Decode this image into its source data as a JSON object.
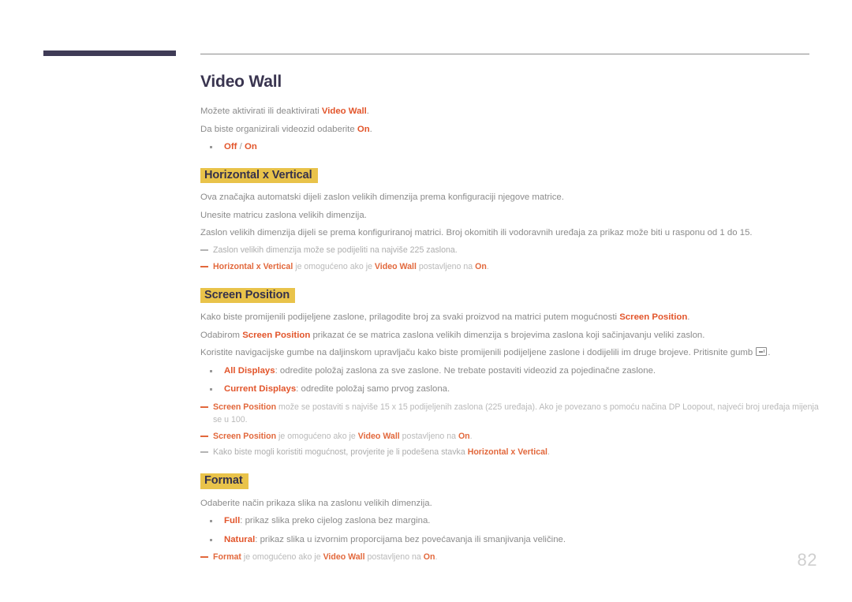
{
  "document": {
    "title": "Video Wall",
    "page_number": "82"
  },
  "colors": {
    "accent_orange": "#e2552b",
    "note_orange": "#e2683c",
    "highlight_gold": "#e9c34a",
    "title_navy": "#3a3550",
    "header_bar_navy": "#3f3b56",
    "body_gray": "#8b8b8b",
    "note_gray": "#adadad",
    "page_number_gray": "#cfcfcf"
  },
  "intro": {
    "line1_pre": "Možete aktivirati ili deaktivirati ",
    "line1_em": "Video Wall",
    "line1_post": ".",
    "line2_pre": "Da biste organizirali videozid odaberite ",
    "line2_em": "On",
    "line2_post": ".",
    "option_off": "Off",
    "option_slash": " / ",
    "option_on": "On"
  },
  "sections": [
    {
      "heading": "Horizontal x Vertical",
      "paragraphs": [
        "Ova značajka automatski dijeli zaslon velikih dimenzija prema konfiguraciji njegove matrice.",
        "Unesite matricu zaslona velikih dimenzija.",
        "Zaslon velikih dimenzija dijeli se prema konfiguriranoj matrici. Broj okomitih ili vodoravnih uređaja za prikaz može biti u rasponu od 1 do 15."
      ],
      "notes": [
        {
          "style": "gray",
          "parts": [
            {
              "text": "Zaslon velikih dimenzija može se podijeliti na najviše 225 zaslona.",
              "emphasis": false
            }
          ]
        },
        {
          "style": "accent",
          "parts": [
            {
              "text": "Horizontal x Vertical",
              "emphasis": true
            },
            {
              "text": " je omogućeno ako je ",
              "emphasis": false
            },
            {
              "text": "Video Wall",
              "emphasis": true
            },
            {
              "text": " postavljeno na ",
              "emphasis": false
            },
            {
              "text": "On",
              "emphasis": true
            },
            {
              "text": ".",
              "emphasis": false
            }
          ]
        }
      ]
    },
    {
      "heading": "Screen Position",
      "paragraphs_rich": [
        [
          {
            "text": "Kako biste promijenili podijeljene zaslone, prilagodite broj za svaki proizvod na matrici putem mogućnosti ",
            "emphasis": false
          },
          {
            "text": "Screen Position",
            "emphasis": true
          },
          {
            "text": ".",
            "emphasis": false
          }
        ],
        [
          {
            "text": "Odabirom ",
            "emphasis": false
          },
          {
            "text": "Screen Position",
            "emphasis": true
          },
          {
            "text": " prikazat će se matrica zaslona velikih dimenzija s brojevima zaslona koji sačinjavanju veliki zaslon.",
            "emphasis": false
          }
        ],
        [
          {
            "text": "Koristite navigacijske gumbe na daljinskom upravljaču kako biste promijenili podijeljene zaslone i dodijelili im druge brojeve. Pritisnite gumb ",
            "emphasis": false
          },
          {
            "text": "ENTER_KEY_ICON",
            "emphasis": false,
            "icon": true
          },
          {
            "text": ".",
            "emphasis": false
          }
        ]
      ],
      "bullets": [
        [
          {
            "text": "All Displays",
            "emphasis": true
          },
          {
            "text": ": odredite položaj zaslona za sve zaslone. Ne trebate postaviti videozid za pojedinačne zaslone.",
            "emphasis": false
          }
        ],
        [
          {
            "text": "Current Displays",
            "emphasis": true
          },
          {
            "text": ": odredite položaj samo prvog zaslona.",
            "emphasis": false
          }
        ]
      ],
      "notes": [
        {
          "style": "accent",
          "parts": [
            {
              "text": "Screen Position",
              "emphasis": true
            },
            {
              "text": " može se postaviti s najviše 15 x 15 podijeljenih zaslona (225 uređaja). Ako je povezano s pomoću načina DP Loopout, najveći broj uređaja mijenja se u 100.",
              "emphasis": false
            }
          ]
        },
        {
          "style": "accent",
          "parts": [
            {
              "text": "Screen Position",
              "emphasis": true
            },
            {
              "text": " je omogućeno ako je ",
              "emphasis": false
            },
            {
              "text": "Video Wall",
              "emphasis": true
            },
            {
              "text": " postavljeno na ",
              "emphasis": false
            },
            {
              "text": "On",
              "emphasis": true
            },
            {
              "text": ".",
              "emphasis": false
            }
          ]
        },
        {
          "style": "gray",
          "parts": [
            {
              "text": "Kako biste mogli koristiti mogućnost, provjerite je li podešena stavka ",
              "emphasis": false
            },
            {
              "text": "Horizontal x Vertical",
              "emphasis": true
            },
            {
              "text": ".",
              "emphasis": false
            }
          ]
        }
      ]
    },
    {
      "heading": "Format",
      "paragraphs": [
        "Odaberite način prikaza slika na zaslonu velikih dimenzija."
      ],
      "bullets": [
        [
          {
            "text": "Full",
            "emphasis": true
          },
          {
            "text": ": prikaz slika preko cijelog zaslona bez margina.",
            "emphasis": false
          }
        ],
        [
          {
            "text": "Natural",
            "emphasis": true
          },
          {
            "text": ": prikaz slika u izvornim proporcijama bez povećavanja ili smanjivanja veličine.",
            "emphasis": false
          }
        ]
      ],
      "notes": [
        {
          "style": "accent",
          "parts": [
            {
              "text": "Format",
              "emphasis": true
            },
            {
              "text": " je omogućeno ako je ",
              "emphasis": false
            },
            {
              "text": "Video Wall",
              "emphasis": true
            },
            {
              "text": " postavljeno na ",
              "emphasis": false
            },
            {
              "text": "On",
              "emphasis": true
            },
            {
              "text": ".",
              "emphasis": false
            }
          ]
        }
      ]
    }
  ]
}
